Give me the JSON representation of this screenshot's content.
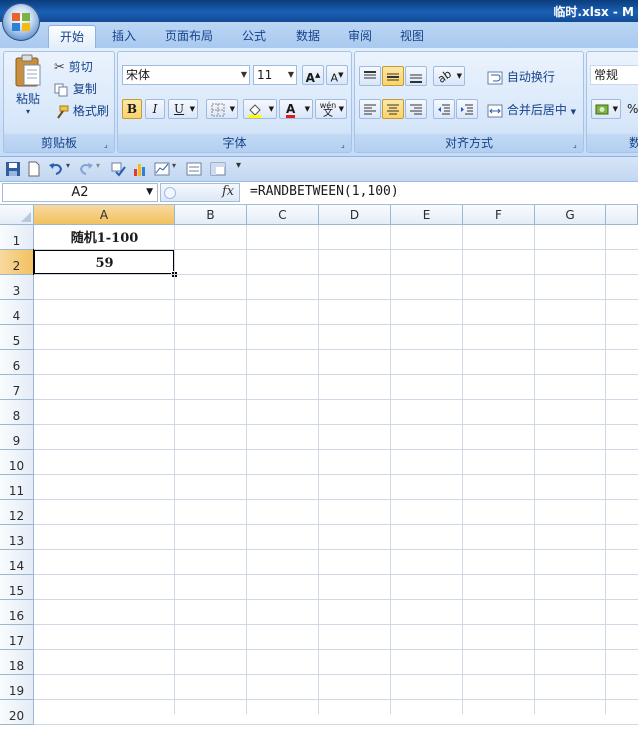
{
  "window": {
    "title": "临时.xlsx - M"
  },
  "tabs": [
    "开始",
    "插入",
    "页面布局",
    "公式",
    "数据",
    "审阅",
    "视图"
  ],
  "ribbon": {
    "clipboard": {
      "label": "剪贴板",
      "paste": "粘贴",
      "cut": "剪切",
      "copy": "复制",
      "format_painter": "格式刷"
    },
    "font": {
      "label": "字体",
      "font_name": "宋体",
      "font_size": "11",
      "bold": "B",
      "italic": "I",
      "underline": "U",
      "font_color_glyph": "A",
      "grow": "A",
      "shrink": "A",
      "phonetic": "wén",
      "phonetic_char": "文"
    },
    "alignment": {
      "label": "对齐方式",
      "wrap_text": "自动换行",
      "merge_center": "合并后居中"
    },
    "number": {
      "format": "常规",
      "percent": "%",
      "label_partial": "数"
    }
  },
  "formula_bar": {
    "name_box": "A2",
    "fx": "fx",
    "formula": "=RANDBETWEEN(1,100)"
  },
  "grid": {
    "columns": [
      "A",
      "B",
      "C",
      "D",
      "E",
      "F",
      "G"
    ],
    "rows": [
      "1",
      "2",
      "3",
      "4",
      "5",
      "6",
      "7",
      "8",
      "9",
      "10",
      "11",
      "12",
      "13",
      "14",
      "15",
      "16",
      "17",
      "18",
      "19",
      "20"
    ],
    "selected_cell": "A2",
    "cells": {
      "A1": "随机1-100",
      "A2": "59"
    }
  },
  "colors": {
    "accent": "#15428b",
    "selection_header": "#f1c15f",
    "gridline": "#d0d7e5"
  }
}
